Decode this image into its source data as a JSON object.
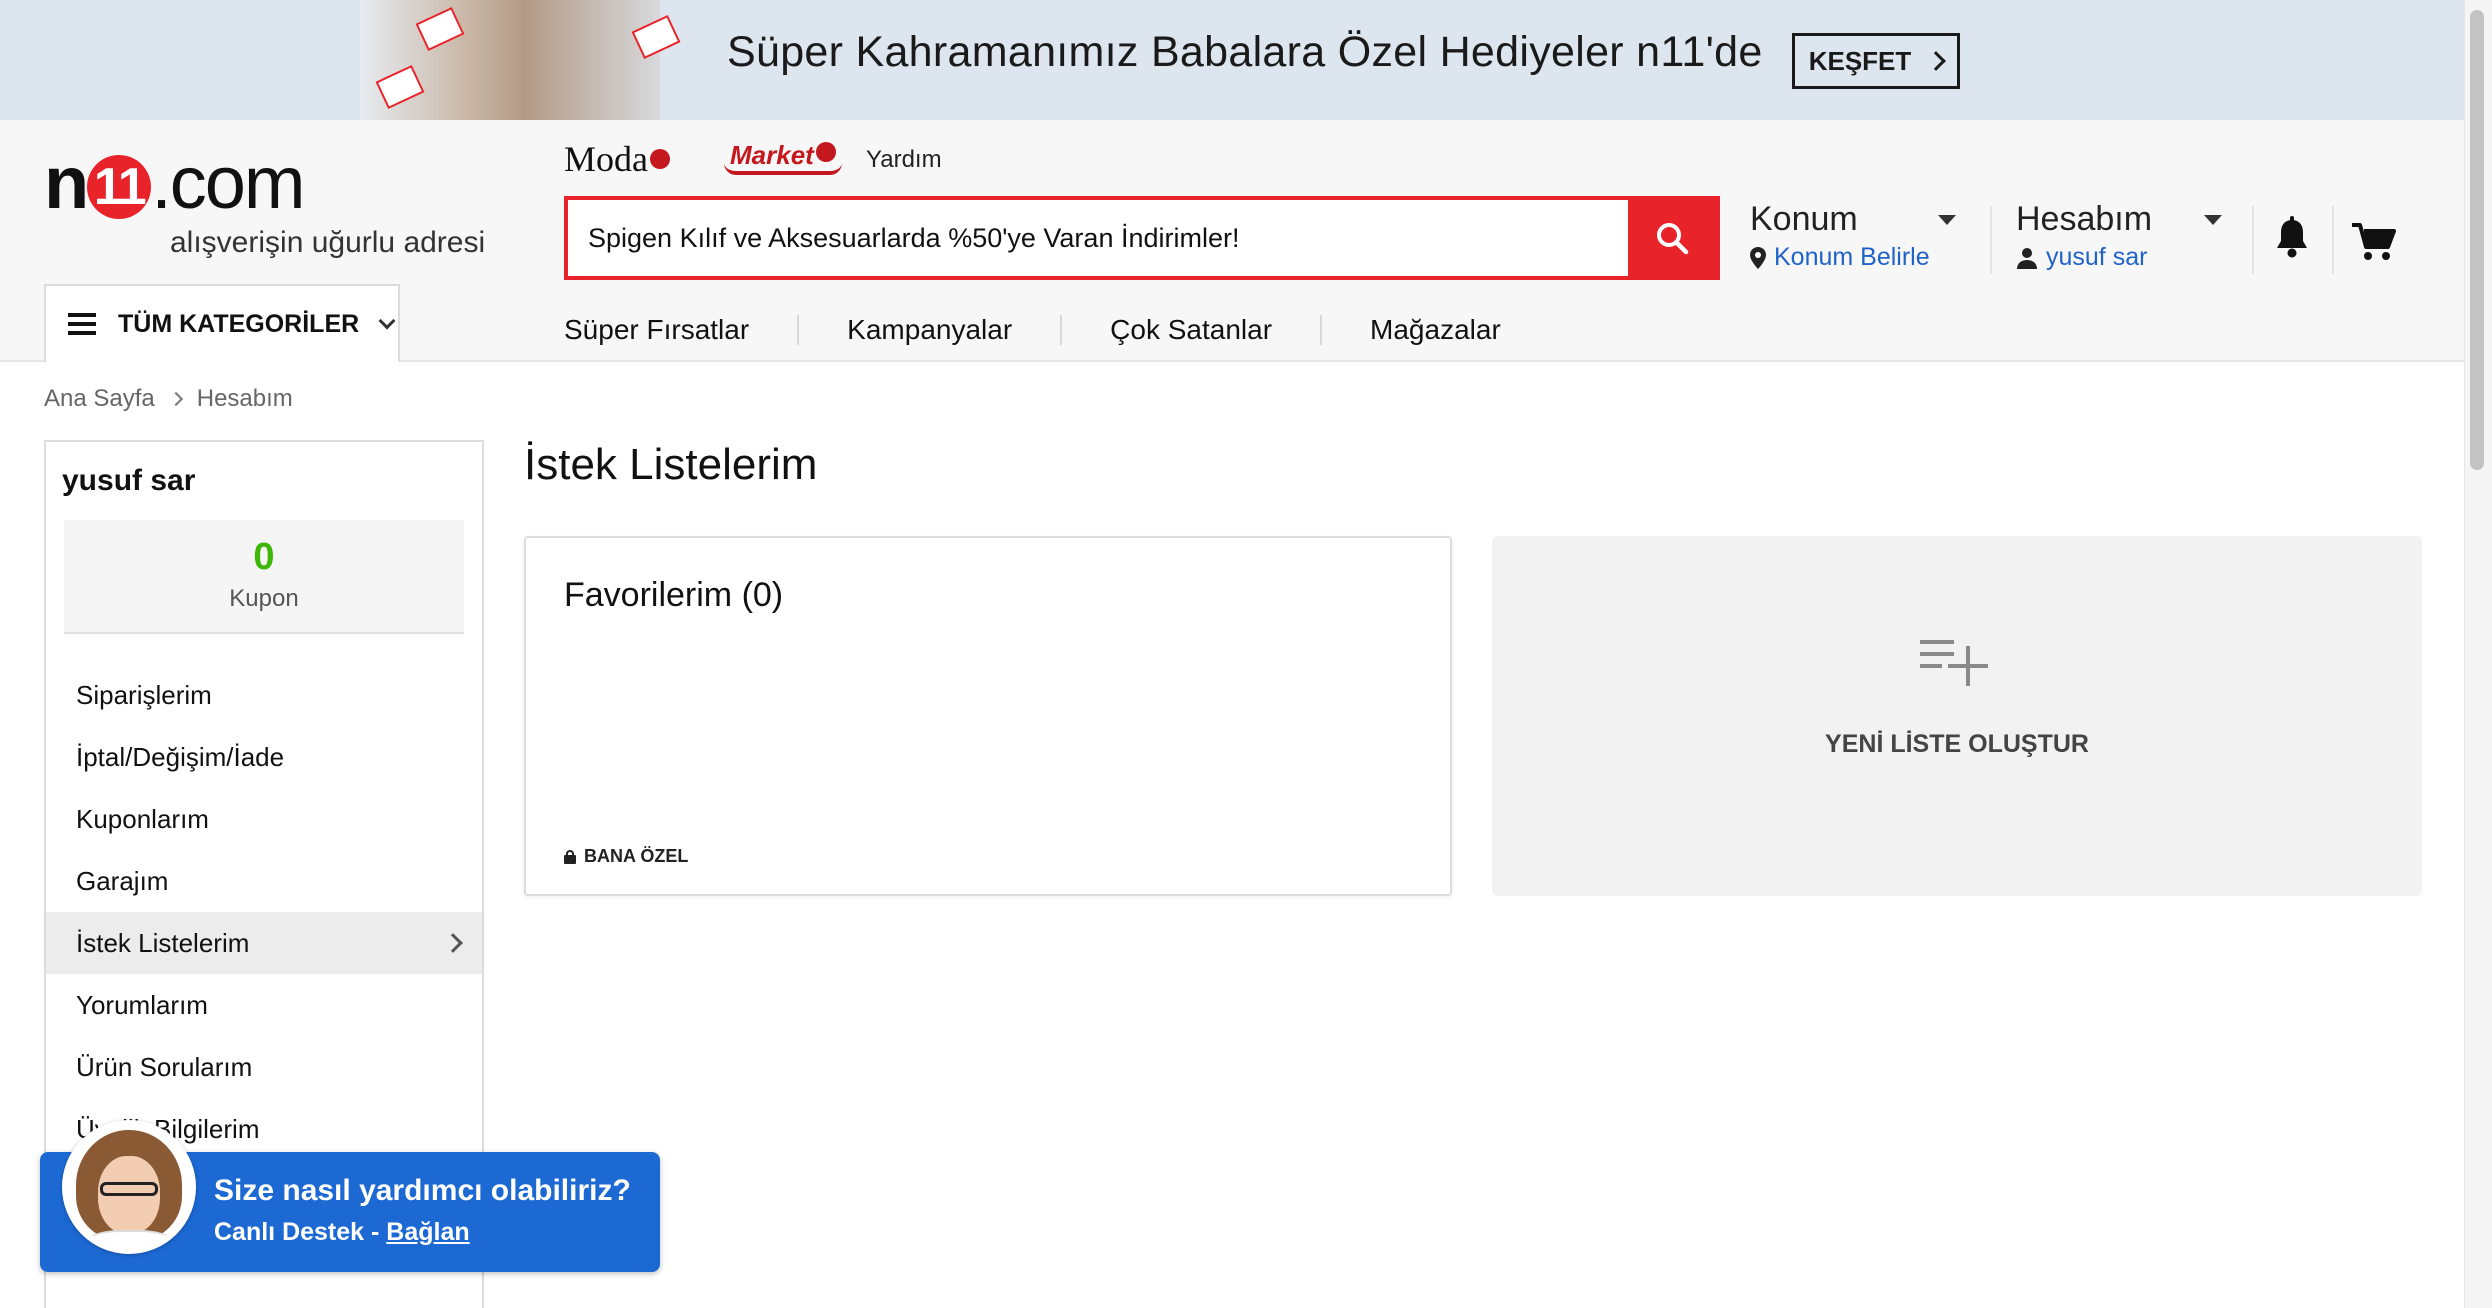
{
  "promo": {
    "text": "Süper Kahramanımız Babalara Özel Hediyeler n11'de",
    "button": "KEŞFET"
  },
  "header": {
    "logo_prefix": "n",
    "logo_ones": "11",
    "logo_suffix": ".com",
    "tagline": "alışverişin uğurlu adresi",
    "links": {
      "moda": "Moda",
      "market": "Market",
      "yardim": "Yardım"
    }
  },
  "search": {
    "value": "Spigen Kılıf ve Aksesuarlarda %50'ye Varan İndirimler!",
    "icon": "search-icon"
  },
  "konum": {
    "title": "Konum",
    "sub": "Konum Belirle"
  },
  "account": {
    "title": "Hesabım",
    "user": "yusuf sar"
  },
  "categories_button": "TÜM KATEGORİLER",
  "nav": [
    "Süper Fırsatlar",
    "Kampanyalar",
    "Çok Satanlar",
    "Mağazalar"
  ],
  "breadcrumb": [
    "Ana Sayfa",
    "Hesabım"
  ],
  "sidebar": {
    "name": "yusuf sar",
    "coupon_count": "0",
    "coupon_label": "Kupon",
    "items": [
      "Siparişlerim",
      "İptal/Değişim/İade",
      "Kuponlarım",
      "Garajım",
      "İstek Listelerim",
      "Yorumlarım",
      "Ürün Sorularım",
      "Üyelik Bilgilerim"
    ],
    "active_index": 4
  },
  "content": {
    "title": "İstek Listelerim",
    "favorites_title": "Favorilerim (0)",
    "favorites_privacy": "BANA ÖZEL",
    "new_list_label": "YENİ LİSTE OLUŞTUR"
  },
  "support": {
    "title": "Size nasıl yardımcı olabiliriz?",
    "sub_lead": "Canlı Destek - ",
    "sub_link": "Bağlan"
  },
  "colors": {
    "brand_red": "#e8232a",
    "link_blue": "#1f62c8",
    "support_blue": "#1c69d4",
    "coupon_green": "#3fb70a"
  }
}
